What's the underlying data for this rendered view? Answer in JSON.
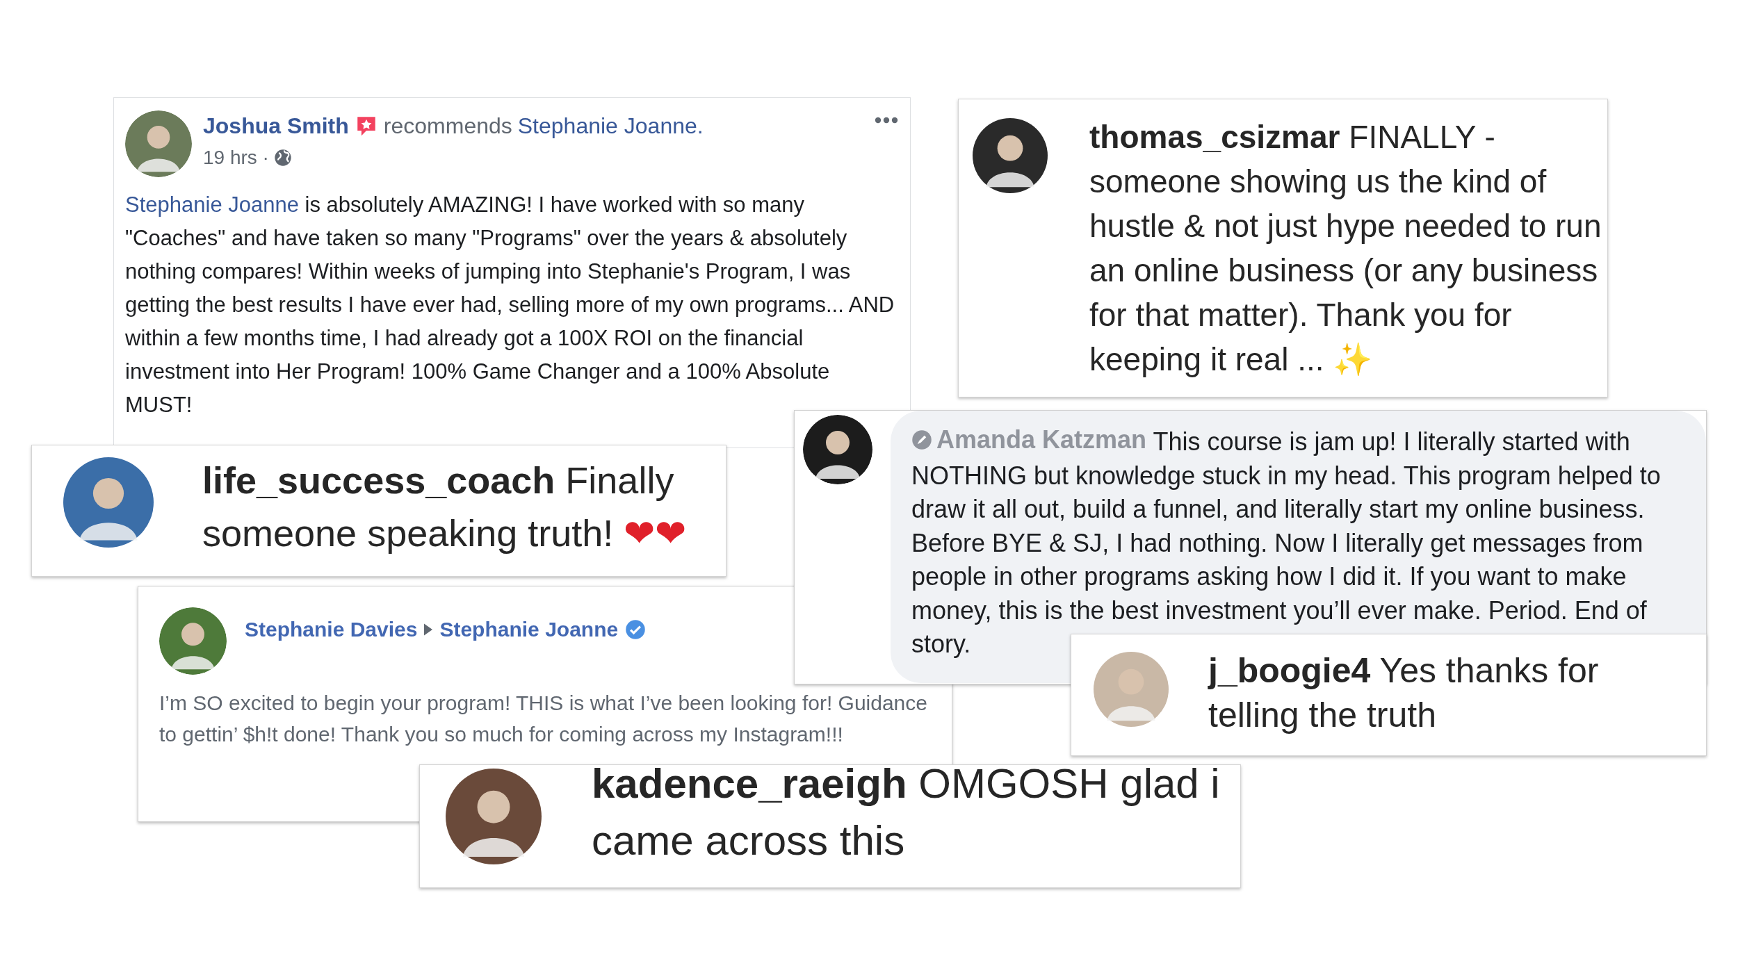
{
  "cards": [
    {
      "kind": "recommendation",
      "author": "Joshua Smith",
      "verb": "recommends",
      "page": "Stephanie Joanne.",
      "time": "19 hrs ·",
      "mention": "Stephanie Joanne",
      "body": " is absolutely AMAZING! I have worked with so many \"Coaches\" and have taken so many \"Programs\" over the years & absolutely nothing compares! Within weeks of jumping into Stephanie's Program, I was getting the best results I have ever had, selling more of my own programs... AND within a few months time, I had already got a 100X ROI on the financial investment into Her Program! 100% Game Changer and a 100% Absolute MUST!"
    },
    {
      "kind": "ig_comment",
      "username": "thomas_csizmar",
      "text": "FINALLY - someone showing us the kind of hustle & not just hype needed to run an online business (or any business for that matter). Thank you for keeping it real ...",
      "emoji": "✨"
    },
    {
      "kind": "ig_comment",
      "username": "life_success_coach",
      "text": "Finally someone speaking truth!",
      "emoji": "❤❤"
    },
    {
      "kind": "wall_post",
      "author": "Stephanie Davies",
      "target": "Stephanie Joanne",
      "verified": true,
      "body": "I’m SO excited to begin your program! THIS is what I’ve been looking for! Guidance to gettin’ $h!t done! Thank you so much for coming across my Instagram!!!"
    },
    {
      "kind": "fb_comment",
      "author": "Amanda Katzman",
      "text": "This course is jam up! I literally started with NOTHING but knowledge stuck in my head. This program helped to draw it all out, build a funnel, and literally start my online business. Before BYE & SJ, I had nothing. Now I literally get messages from people in other programs asking how I did it. If you want to make money, this is the best investment you’ll ever make. Period. End of story."
    },
    {
      "kind": "ig_comment",
      "username": "j_boogie4",
      "text": "Yes thanks for telling the truth"
    },
    {
      "kind": "ig_comment",
      "username": "kadence_raeigh",
      "text": "OMGOSH glad i came across this"
    }
  ]
}
